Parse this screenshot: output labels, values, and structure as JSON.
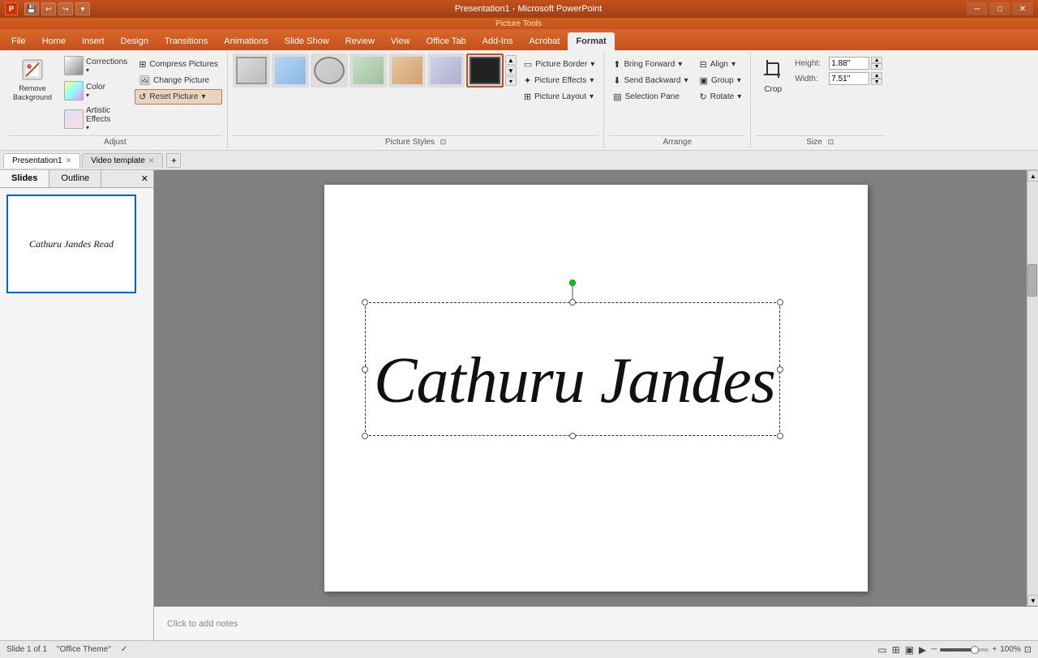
{
  "titleBar": {
    "appName": "Presentation1 - Microsoft PowerPoint",
    "pictureToolsLabel": "Picture Tools",
    "controls": [
      "─",
      "□",
      "✕"
    ]
  },
  "quickAccess": {
    "buttons": [
      "💾",
      "↩",
      "↪"
    ]
  },
  "ribbonTabs": {
    "contextLabel": "Picture Tools",
    "tabs": [
      "File",
      "Home",
      "Insert",
      "Design",
      "Transitions",
      "Animations",
      "Slide Show",
      "Review",
      "View",
      "Office Tab",
      "Add-Ins",
      "Acrobat",
      "Format"
    ]
  },
  "adjustGroup": {
    "label": "Adjust",
    "removeBackground": "Remove\nBackground",
    "corrections": "Corrections",
    "color": "Color",
    "artisticEffects": "Artistic\nEffects",
    "compressPictures": "Compress Pictures",
    "changePicture": "Change Picture",
    "resetPicture": "Reset Picture"
  },
  "pictureStylesGroup": {
    "label": "Picture Styles",
    "styles": [
      {
        "id": 1,
        "label": "Style 1"
      },
      {
        "id": 2,
        "label": "Style 2"
      },
      {
        "id": 3,
        "label": "Style 3"
      },
      {
        "id": 4,
        "label": "Style 4"
      },
      {
        "id": 5,
        "label": "Style 5"
      },
      {
        "id": 6,
        "label": "Style 6"
      },
      {
        "id": 7,
        "label": "Style 7 (active)"
      }
    ],
    "pictureBorder": "Picture Border",
    "pictureEffects": "Picture Effects",
    "pictureLayout": "Picture Layout"
  },
  "arrangeGroup": {
    "label": "Arrange",
    "bringForward": "Bring Forward",
    "sendBackward": "Send Backward",
    "selectionPane": "Selection Pane",
    "align": "Align",
    "group": "Group",
    "rotate": "Rotate"
  },
  "sizeGroup": {
    "label": "Size",
    "height": "Height:",
    "heightValue": "1.88\"",
    "width": "Width:",
    "widthValue": "7.51\"",
    "cropLabel": "Crop"
  },
  "docTabs": [
    {
      "label": "Presentation1",
      "closeable": true,
      "active": true
    },
    {
      "label": "Video template",
      "closeable": true,
      "active": false
    }
  ],
  "slideTabs": [
    "Slides",
    "Outline"
  ],
  "slideCanvas": {
    "scriptText": "Cathuru Jandes Read",
    "notesPlaceholder": "Click to add notes"
  },
  "statusBar": {
    "slideInfo": "Slide 1 of 1",
    "theme": "\"Office Theme\"",
    "zoomPercent": "100%",
    "viewIcons": [
      "□□",
      "□",
      "▦",
      "▣"
    ]
  }
}
